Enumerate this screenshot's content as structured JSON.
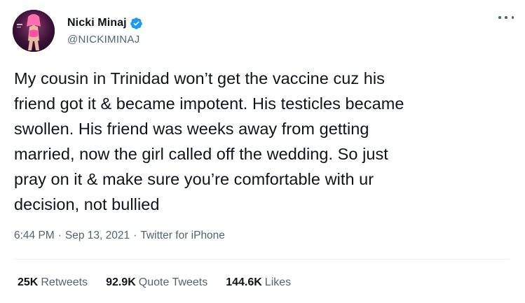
{
  "author": {
    "display_name": "Nicki Minaj",
    "handle": "@NICKIMINAJ",
    "verified": true
  },
  "tweet": {
    "text": "My cousin in Trinidad won’t get the vaccine cuz his\nfriend got it & became impotent. His testicles became\nswollen. His friend was weeks away from getting\nmarried, now the girl called off the wedding. So just\npray on it & make sure you’re comfortable with ur\ndecision, not bullied",
    "time": "6:44 PM",
    "separator": "·",
    "date": "Sep 13, 2021",
    "source": "Twitter for iPhone"
  },
  "stats": {
    "retweets_count": "25K",
    "retweets_label": "Retweets",
    "quote_count": "92.9K",
    "quote_label": "Quote Tweets",
    "likes_count": "144.6K",
    "likes_label": "Likes"
  },
  "colors": {
    "text_primary": "#0f1419",
    "text_secondary": "#536471",
    "verified_blue": "#1d9bf0",
    "divider": "#eff3f4"
  },
  "icons": {
    "verified": "verified-badge-icon",
    "more": "more-options-icon"
  }
}
